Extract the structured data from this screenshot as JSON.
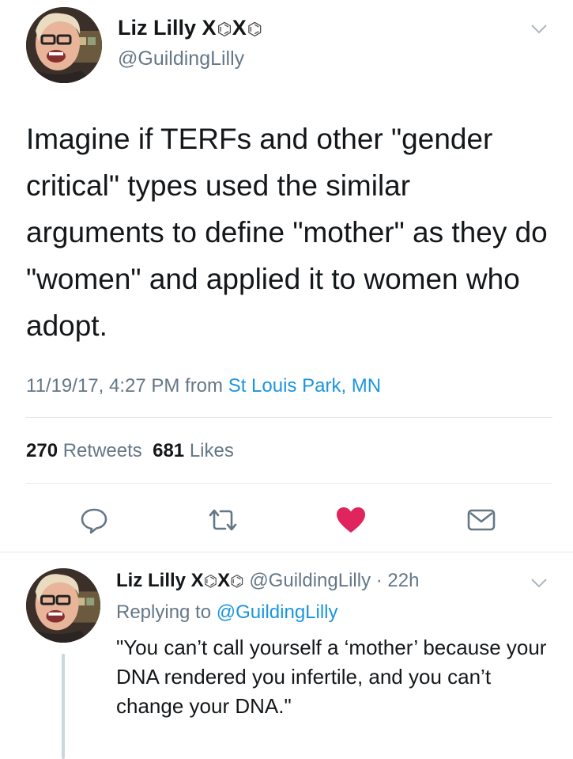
{
  "tweet": {
    "author_name": "Liz Lilly X",
    "name_glyph_1": "⌬",
    "name_x": "X",
    "name_glyph_2": "⌬",
    "handle": "@GuildingLilly",
    "text": "Imagine if TERFs and other \"gender critical\" types used the similar arguments to define \"mother\" as they do \"women\" and applied it to women who adopt.",
    "timestamp": "11/19/17, 4:27 PM from ",
    "location": "St Louis Park, MN",
    "retweets_count": "270",
    "retweets_label": "Retweets",
    "likes_count": "681",
    "likes_label": "Likes"
  },
  "reply": {
    "author_name": "Liz Lilly X",
    "name_glyph_1": "⌬",
    "name_x": "X",
    "name_glyph_2": "⌬",
    "handle_time": "@GuildingLilly · 22h",
    "replying_prefix": "Replying to ",
    "replying_handle": "@GuildingLilly",
    "text": "\"You can’t call yourself a ‘mother’ because your DNA rendered you infertile, and you can’t change your DNA.\""
  },
  "actions": {
    "reply_icon": "speech-bubble",
    "retweet_icon": "retweet-arrows",
    "like_icon": "heart-filled",
    "message_icon": "envelope"
  },
  "colors": {
    "like_active": "#e0245e",
    "link": "#1b95e0",
    "secondary_text": "#657786",
    "divider": "#e1e8ed"
  }
}
